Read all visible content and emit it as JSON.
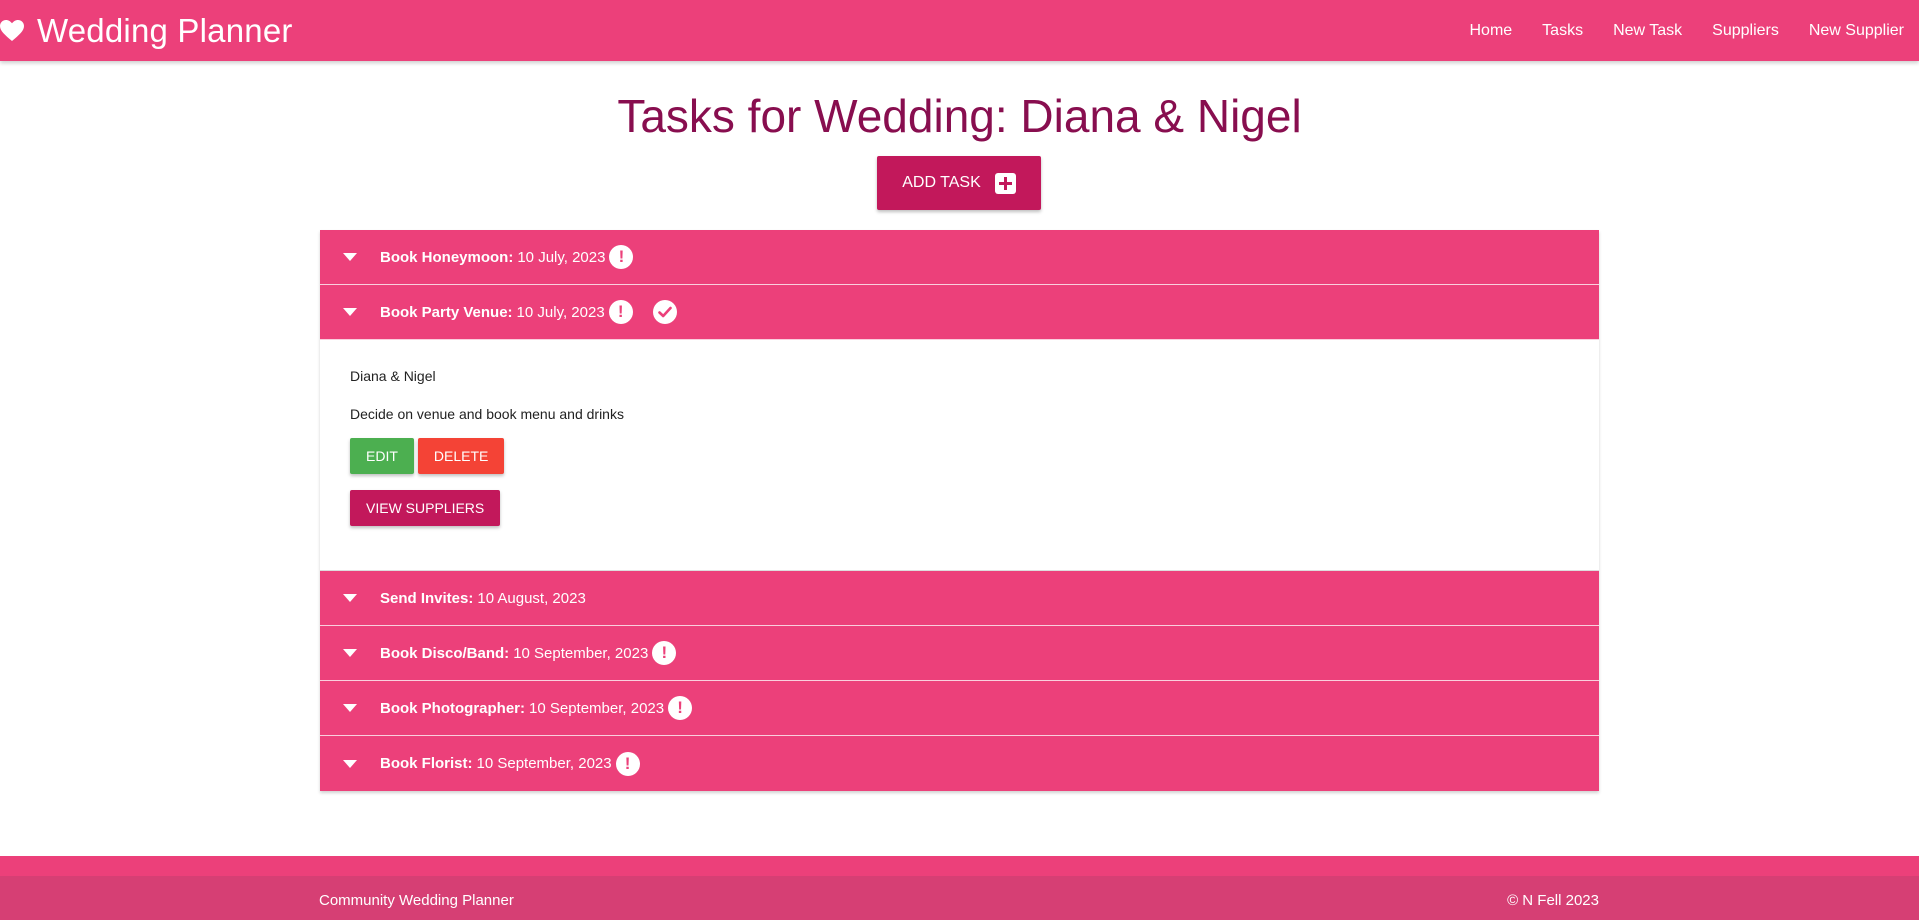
{
  "nav": {
    "brand": "Wedding Planner",
    "links": [
      "Home",
      "Tasks",
      "New Task",
      "Suppliers",
      "New Supplier"
    ]
  },
  "page": {
    "title": "Tasks for Wedding: Diana & Nigel",
    "add_task_label": "ADD TASK"
  },
  "tasks": [
    {
      "name": "Book Honeymoon:",
      "date": "10 July, 2023",
      "overdue": true,
      "done": false
    },
    {
      "name": "Book Party Venue:",
      "date": "10 July, 2023",
      "overdue": true,
      "done": true,
      "expanded": true,
      "couple": "Diana & Nigel",
      "description": "Decide on venue and book menu and drinks",
      "edit_label": "EDIT",
      "delete_label": "DELETE",
      "suppliers_label": "VIEW SUPPLIERS"
    },
    {
      "name": "Send Invites:",
      "date": "10 August, 2023",
      "overdue": false,
      "done": false
    },
    {
      "name": "Book Disco/Band:",
      "date": "10 September, 2023",
      "overdue": true,
      "done": false
    },
    {
      "name": "Book Photographer:",
      "date": "10 September, 2023",
      "overdue": true,
      "done": false
    },
    {
      "name": "Book Florist:",
      "date": "10 September, 2023",
      "overdue": true,
      "done": false
    }
  ],
  "icons": {
    "brand": "heart-icon",
    "add": "plus-square-icon",
    "expand": "caret-down-icon",
    "overdue": "exclamation-circle-icon",
    "done": "check-circle-icon"
  },
  "colors": {
    "primary": "#ec407a",
    "dark": "#c2185b",
    "title": "#880e4f",
    "edit": "#4caf50",
    "delete": "#f44336",
    "footer": "#d63f74"
  },
  "footer": {
    "left": "Community Wedding Planner",
    "right": "© N Fell 2023"
  }
}
